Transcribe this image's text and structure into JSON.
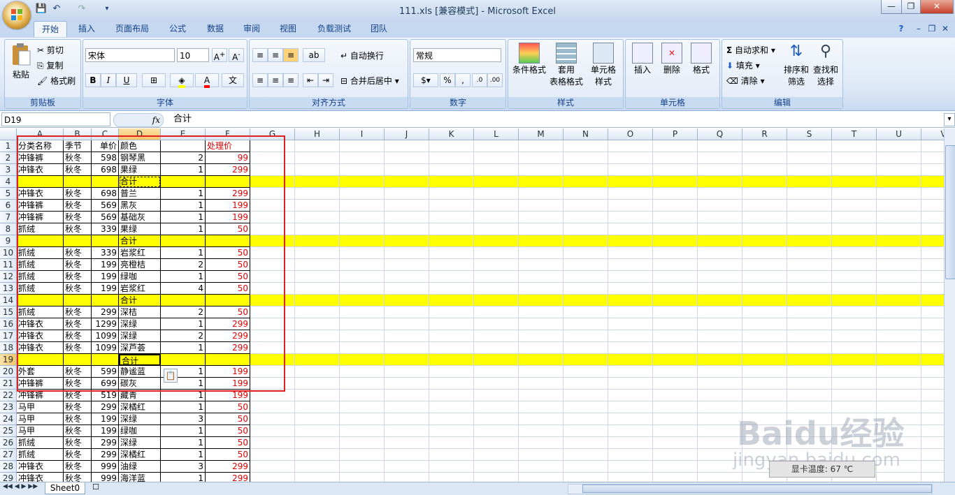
{
  "window": {
    "title": "111.xls  [兼容模式] - Microsoft Excel",
    "min": "—",
    "max": "❐",
    "close": "✕"
  },
  "qat": {
    "save": "💾",
    "undo": "↶",
    "redo": "↷"
  },
  "tabs": [
    "开始",
    "插入",
    "页面布局",
    "公式",
    "数据",
    "审阅",
    "视图",
    "负载测试",
    "团队"
  ],
  "ribbon": {
    "clipboard": {
      "label": "剪贴板",
      "paste": "粘贴",
      "cut": "剪切",
      "copy": "复制",
      "format_painter": "格式刷"
    },
    "font": {
      "label": "字体",
      "name": "宋体",
      "size": "10"
    },
    "alignment": {
      "label": "对齐方式",
      "wrap": "自动换行",
      "merge": "合并后居中"
    },
    "number": {
      "label": "数字",
      "format": "常规"
    },
    "styles": {
      "label": "样式",
      "conditional": "条件格式",
      "table1": "套用",
      "table2": "表格格式",
      "cell1": "单元格",
      "cell2": "样式"
    },
    "cells": {
      "label": "单元格",
      "insert": "插入",
      "delete": "删除",
      "format": "格式"
    },
    "editing": {
      "label": "编辑",
      "autosum": "自动求和",
      "fill": "填充",
      "clear": "清除",
      "sort1": "排序和",
      "sort2": "筛选",
      "find1": "查找和",
      "find2": "选择"
    }
  },
  "formula_bar": {
    "name_box": "D19",
    "fx": "fx",
    "content": "合计"
  },
  "columns": [
    "A",
    "B",
    "C",
    "D",
    "E",
    "F",
    "G",
    "H",
    "I",
    "J",
    "K",
    "L",
    "M",
    "N",
    "O",
    "P",
    "Q",
    "R",
    "S",
    "T",
    "U",
    "V"
  ],
  "rows": [
    {
      "n": "1",
      "c": [
        "分类名称",
        "季节",
        "单价",
        "颜色",
        "",
        "处理价"
      ]
    },
    {
      "n": "2",
      "c": [
        "冲锋裤",
        "秋冬",
        "598",
        "钢琴黑",
        "2",
        "99"
      ]
    },
    {
      "n": "3",
      "c": [
        "冲锋衣",
        "秋冬",
        "698",
        "果绿",
        "1",
        "299"
      ]
    },
    {
      "n": "4",
      "c": [
        "",
        "",
        "",
        "合计",
        "",
        ""
      ],
      "y": true
    },
    {
      "n": "5",
      "c": [
        "冲锋衣",
        "秋冬",
        "698",
        "普兰",
        "1",
        "299"
      ]
    },
    {
      "n": "6",
      "c": [
        "冲锋裤",
        "秋冬",
        "569",
        "黑灰",
        "1",
        "199"
      ]
    },
    {
      "n": "7",
      "c": [
        "冲锋裤",
        "秋冬",
        "569",
        "基础灰",
        "1",
        "199"
      ]
    },
    {
      "n": "8",
      "c": [
        "抓绒",
        "秋冬",
        "339",
        "果绿",
        "1",
        "50"
      ]
    },
    {
      "n": "9",
      "c": [
        "",
        "",
        "",
        "合计",
        "",
        ""
      ],
      "y": true
    },
    {
      "n": "10",
      "c": [
        "抓绒",
        "秋冬",
        "339",
        "岩浆红",
        "1",
        "50"
      ]
    },
    {
      "n": "11",
      "c": [
        "抓绒",
        "秋冬",
        "199",
        "亮橙桔",
        "2",
        "50"
      ]
    },
    {
      "n": "12",
      "c": [
        "抓绒",
        "秋冬",
        "199",
        "绿咖",
        "1",
        "50"
      ]
    },
    {
      "n": "13",
      "c": [
        "抓绒",
        "秋冬",
        "199",
        "岩浆红",
        "4",
        "50"
      ]
    },
    {
      "n": "14",
      "c": [
        "",
        "",
        "",
        "合计",
        "",
        ""
      ],
      "y": true
    },
    {
      "n": "15",
      "c": [
        "抓绒",
        "秋冬",
        "299",
        "深桔",
        "2",
        "50"
      ]
    },
    {
      "n": "16",
      "c": [
        "冲锋衣",
        "秋冬",
        "1299",
        "深绿",
        "1",
        "299"
      ]
    },
    {
      "n": "17",
      "c": [
        "冲锋衣",
        "秋冬",
        "1099",
        "深绿",
        "2",
        "299"
      ]
    },
    {
      "n": "18",
      "c": [
        "冲锋衣",
        "秋冬",
        "1099",
        "深芦荟",
        "1",
        "299"
      ]
    },
    {
      "n": "19",
      "c": [
        "",
        "",
        "",
        "合计",
        "",
        ""
      ],
      "y": true
    },
    {
      "n": "20",
      "c": [
        "外套",
        "秋冬",
        "599",
        "静谧蓝",
        "1",
        "199"
      ]
    },
    {
      "n": "21",
      "c": [
        "冲锋裤",
        "秋冬",
        "699",
        "碳灰",
        "1",
        "199"
      ]
    },
    {
      "n": "22",
      "c": [
        "冲锋裤",
        "秋冬",
        "519",
        "藏青",
        "1",
        "199"
      ]
    },
    {
      "n": "23",
      "c": [
        "马甲",
        "秋冬",
        "299",
        "深橘红",
        "1",
        "50"
      ]
    },
    {
      "n": "24",
      "c": [
        "马甲",
        "秋冬",
        "199",
        "深绿",
        "3",
        "50"
      ]
    },
    {
      "n": "25",
      "c": [
        "马甲",
        "秋冬",
        "199",
        "绿咖",
        "1",
        "50"
      ]
    },
    {
      "n": "26",
      "c": [
        "抓绒",
        "秋冬",
        "299",
        "深绿",
        "1",
        "50"
      ]
    },
    {
      "n": "27",
      "c": [
        "抓绒",
        "秋冬",
        "299",
        "深橘红",
        "1",
        "50"
      ]
    },
    {
      "n": "28",
      "c": [
        "冲锋衣",
        "秋冬",
        "999",
        "油绿",
        "3",
        "299"
      ]
    },
    {
      "n": "29",
      "c": [
        "冲锋衣",
        "秋冬",
        "999",
        "海洋蓝",
        "1",
        "299"
      ]
    }
  ],
  "sheet_tab": "Sheet0",
  "status_popup": "显卡温度: 67 ℃",
  "watermark": {
    "brand": "Baidu经验",
    "url": "jingyan.baidu.com"
  }
}
